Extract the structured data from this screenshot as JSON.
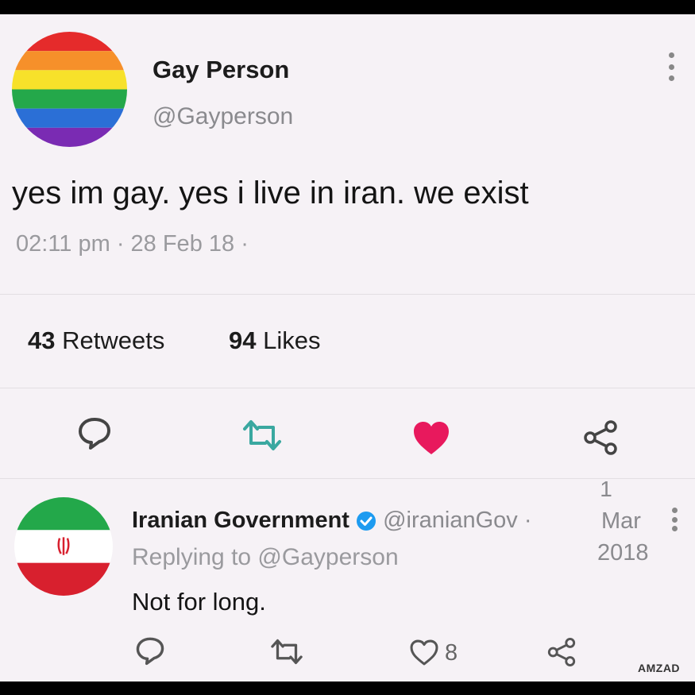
{
  "tweet": {
    "author_name": "Gay Person",
    "author_handle": "@Gayperson",
    "text": "yes im gay. yes i live in iran. we exist",
    "timestamp": "02:11 pm · 28 Feb 18 ·",
    "retweets_count": "43",
    "retweets_label": "Retweets",
    "likes_count": "94",
    "likes_label": "Likes"
  },
  "reply": {
    "author_name": "Iranian Government",
    "author_handle": "@iranianGov",
    "date_sep": "·",
    "date_day": "1",
    "date_month": "Mar",
    "date_year": "2018",
    "replying_to": "Replying to @Gayperson",
    "text": "Not for long.",
    "likes_count": "8"
  },
  "watermark": "AMZAD",
  "colors": {
    "like_active": "#e8195d",
    "retweet_icon": "#3aa8a0",
    "verified": "#1d9bf0",
    "flag_green": "#23a84a",
    "flag_red": "#d8202e"
  },
  "icons": {
    "reply": "speech-bubble-icon",
    "retweet": "retweet-icon",
    "like": "heart-icon",
    "share": "share-icon",
    "more": "more-vertical-icon"
  }
}
